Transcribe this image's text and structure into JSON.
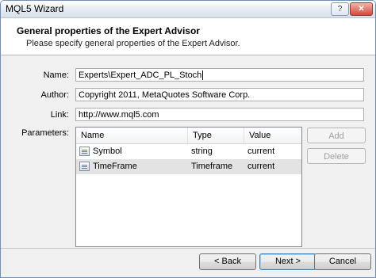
{
  "window": {
    "title": "MQL5 Wizard",
    "help_glyph": "?",
    "close_glyph": "✕"
  },
  "header": {
    "title": "General properties of the Expert Advisor",
    "subtitle": "Please specify general properties of the Expert Advisor."
  },
  "form": {
    "name_label": "Name:",
    "name_value": "Experts\\Expert_ADC_PL_Stoch",
    "author_label": "Author:",
    "author_value": "Copyright 2011, MetaQuotes Software Corp.",
    "link_label": "Link:",
    "link_value": "http://www.mql5.com",
    "parameters_label": "Parameters:"
  },
  "parameters": {
    "columns": [
      "Name",
      "Type",
      "Value"
    ],
    "rows": [
      {
        "name": "Symbol",
        "type": "string",
        "value": "current",
        "icon": "parameter-icon"
      },
      {
        "name": "TimeFrame",
        "type": "Timeframe",
        "value": "current",
        "icon": "parameter-icon"
      }
    ]
  },
  "side_buttons": {
    "add": "Add",
    "delete": "Delete"
  },
  "navigation": {
    "back": "< Back",
    "next": "Next >",
    "cancel": "Cancel"
  }
}
